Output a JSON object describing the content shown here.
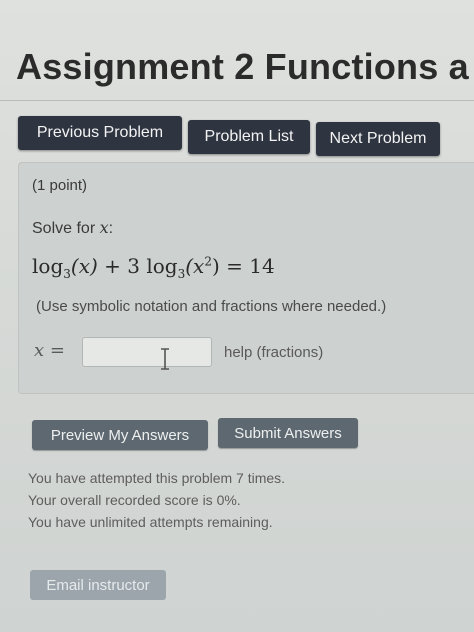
{
  "header": {
    "title": "Assignment 2 Functions a"
  },
  "nav": {
    "previous_label": "Previous Problem",
    "list_label": "Problem List",
    "next_label": "Next Problem"
  },
  "problem": {
    "points": "(1 point)",
    "solve_prefix": "Solve for ",
    "solve_var": "x",
    "solve_suffix": ":",
    "equation": {
      "log": "log",
      "base": "3",
      "term1_arg": "(x)",
      "plus": " + 3 ",
      "term2_arg_open": "(x",
      "exponent": "2",
      "term2_arg_close": ")",
      "equals": " = 14"
    },
    "hint": "(Use symbolic notation and fractions where needed.)",
    "answer_label": "x =",
    "answer_value": "",
    "answer_placeholder": "",
    "help_link": "help (fractions)"
  },
  "actions": {
    "preview_label": "Preview My Answers",
    "submit_label": "Submit Answers"
  },
  "status": {
    "attempts": "You have attempted this problem 7 times.",
    "score": "Your overall recorded score is 0%.",
    "remaining": "You have unlimited attempts remaining."
  },
  "footer": {
    "email_label": "Email instructor"
  },
  "colors": {
    "nav_button_bg": "#2e3440",
    "action_button_bg": "#5e6870",
    "email_button_bg": "#9ba5ab",
    "problem_box_bg": "#cdd1d0"
  }
}
